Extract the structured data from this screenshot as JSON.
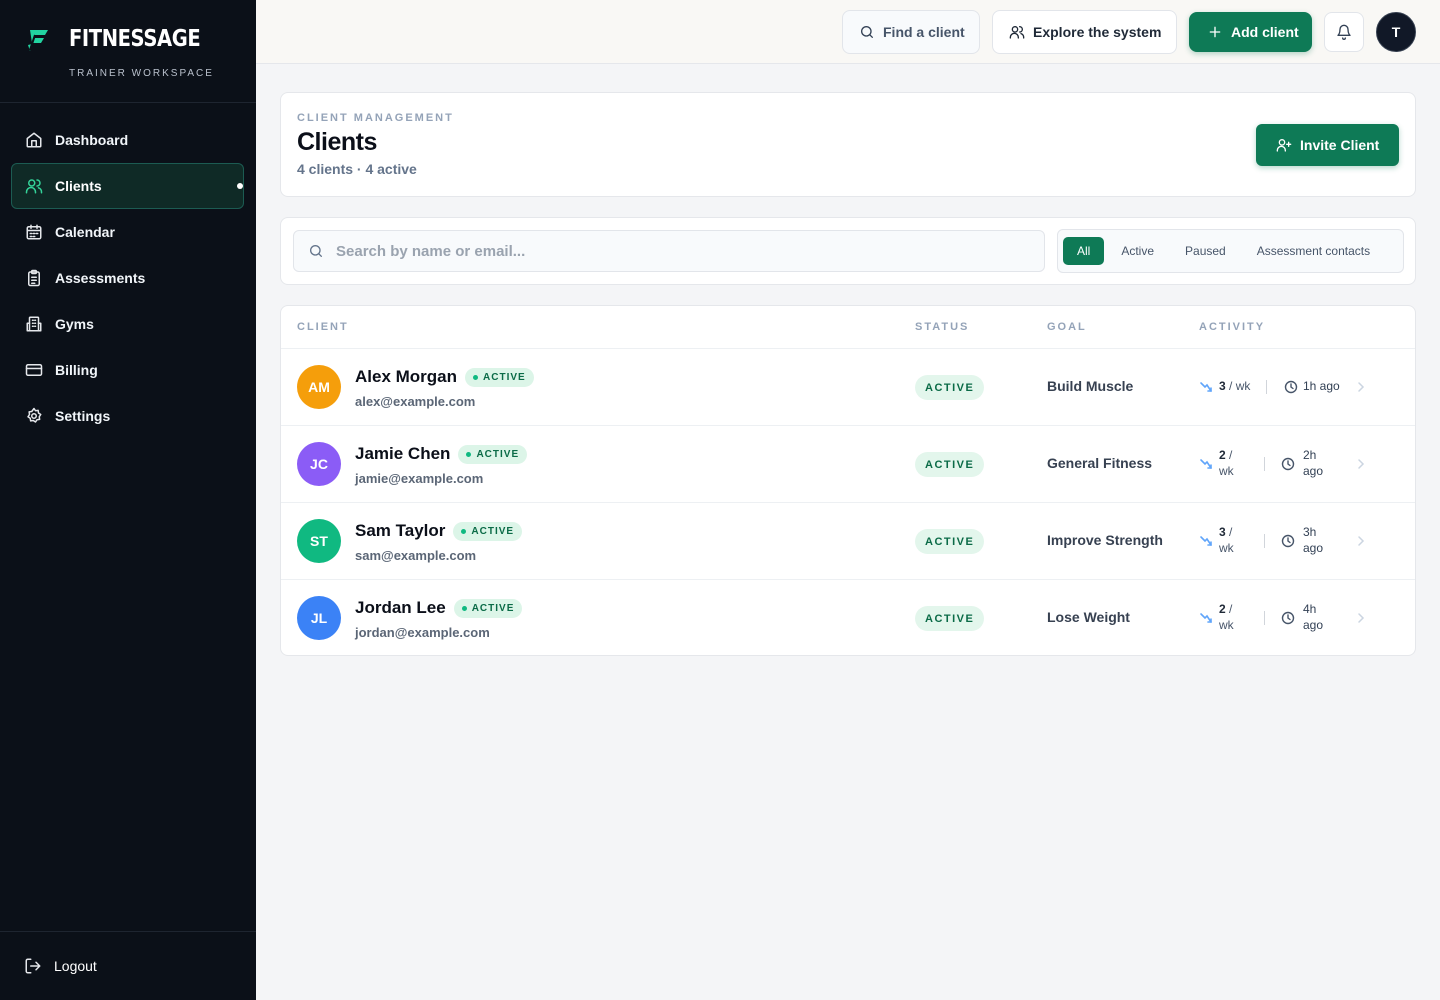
{
  "brand": {
    "name": "FITNESSAGE",
    "subtitle": "TRAINER WORKSPACE",
    "accent": "#22d3a0"
  },
  "sidebar": {
    "items": [
      {
        "label": "Dashboard",
        "icon": "home-icon"
      },
      {
        "label": "Clients",
        "icon": "users-icon",
        "active": true
      },
      {
        "label": "Calendar",
        "icon": "calendar-icon"
      },
      {
        "label": "Assessments",
        "icon": "clipboard-icon"
      },
      {
        "label": "Gyms",
        "icon": "building-icon"
      },
      {
        "label": "Billing",
        "icon": "credit-card-icon"
      },
      {
        "label": "Settings",
        "icon": "gear-icon"
      }
    ],
    "logout": "Logout"
  },
  "topbar": {
    "find": "Find a client",
    "explore": "Explore the system",
    "add": "Add client",
    "avatar_initial": "T"
  },
  "header": {
    "eyebrow": "CLIENT MANAGEMENT",
    "title": "Clients",
    "subtitle": "4 clients · 4 active",
    "invite": "Invite Client"
  },
  "filters": {
    "search_placeholder": "Search by name or email...",
    "segments": [
      "All",
      "Active",
      "Paused",
      "Assessment contacts"
    ],
    "selected": "All"
  },
  "table": {
    "columns": [
      "CLIENT",
      "STATUS",
      "GOAL",
      "ACTIVITY"
    ],
    "rows": [
      {
        "initials": "AM",
        "color": "#f59e0b",
        "name": "Alex Morgan",
        "badge": "ACTIVE",
        "email": "alex@example.com",
        "status": "ACTIVE",
        "goal": "Build Muscle",
        "freq_num": "3",
        "freq_unit": "/ wk",
        "ago": "1h ago"
      },
      {
        "initials": "JC",
        "color": "#8b5cf6",
        "name": "Jamie Chen",
        "badge": "ACTIVE",
        "email": "jamie@example.com",
        "status": "ACTIVE",
        "goal": "General Fitness",
        "freq_num": "2",
        "freq_unit": "/ wk",
        "ago": "2h ago"
      },
      {
        "initials": "ST",
        "color": "#10b981",
        "name": "Sam Taylor",
        "badge": "ACTIVE",
        "email": "sam@example.com",
        "status": "ACTIVE",
        "goal": "Improve Strength",
        "freq_num": "3",
        "freq_unit": "/ wk",
        "ago": "3h ago"
      },
      {
        "initials": "JL",
        "color": "#3b82f6",
        "name": "Jordan Lee",
        "badge": "ACTIVE",
        "email": "jordan@example.com",
        "status": "ACTIVE",
        "goal": "Lose Weight",
        "freq_num": "2",
        "freq_unit": "/ wk",
        "ago": "4h ago"
      }
    ]
  }
}
